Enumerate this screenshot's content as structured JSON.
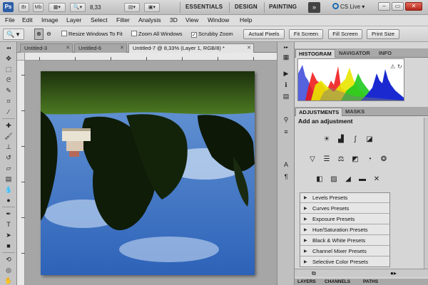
{
  "app": {
    "logo": "Ps",
    "bridge": "Br",
    "minibridge": "Mb",
    "zoom": "8,33",
    "workspaces": [
      "ESSENTIALS",
      "DESIGN",
      "PAINTING"
    ],
    "more": "»",
    "cslive": "CS Live",
    "min": "–",
    "restore": "▭",
    "close": "✕"
  },
  "menu": [
    "File",
    "Edit",
    "Image",
    "Layer",
    "Select",
    "Filter",
    "Analysis",
    "3D",
    "View",
    "Window",
    "Help"
  ],
  "options": {
    "tool": "🔍",
    "resize_windows": "Resize Windows To Fit",
    "resize_checked": false,
    "zoom_all": "Zoom All Windows",
    "zoom_all_checked": false,
    "scrubby": "Scrubby Zoom",
    "scrubby_checked": true,
    "actual_pixels": "Actual Pixels",
    "fit_screen": "Fit Screen",
    "fill_screen": "Fill Screen",
    "print_size": "Print Size"
  },
  "tabs": [
    {
      "label": "Untitled-3",
      "close": "✕"
    },
    {
      "label": "Untitled-6",
      "close": "✕"
    },
    {
      "label": "Untitled-7 @ 8,33% (Layer 1, RGB/8) *",
      "close": "✕"
    }
  ],
  "panels": {
    "top_tabs": [
      "HISTOGRAM",
      "NAVIGATOR",
      "INFO"
    ],
    "adj_tabs": [
      "ADJUSTMENTS",
      "MASKS"
    ],
    "add_adjustment": "Add an adjustment",
    "presets": [
      "Levels Presets",
      "Curves Presets",
      "Exposure Presets",
      "Hue/Saturation Presets",
      "Black & White Presets",
      "Channel Mixer Presets",
      "Selective Color Presets"
    ],
    "bottom_tabs": [
      "LAYERS",
      "CHANNELS",
      "PATHS"
    ]
  },
  "colors": {
    "accent": "#2c5ea8",
    "sky": "#5d8fd3",
    "grass": "#3f6a1c"
  }
}
